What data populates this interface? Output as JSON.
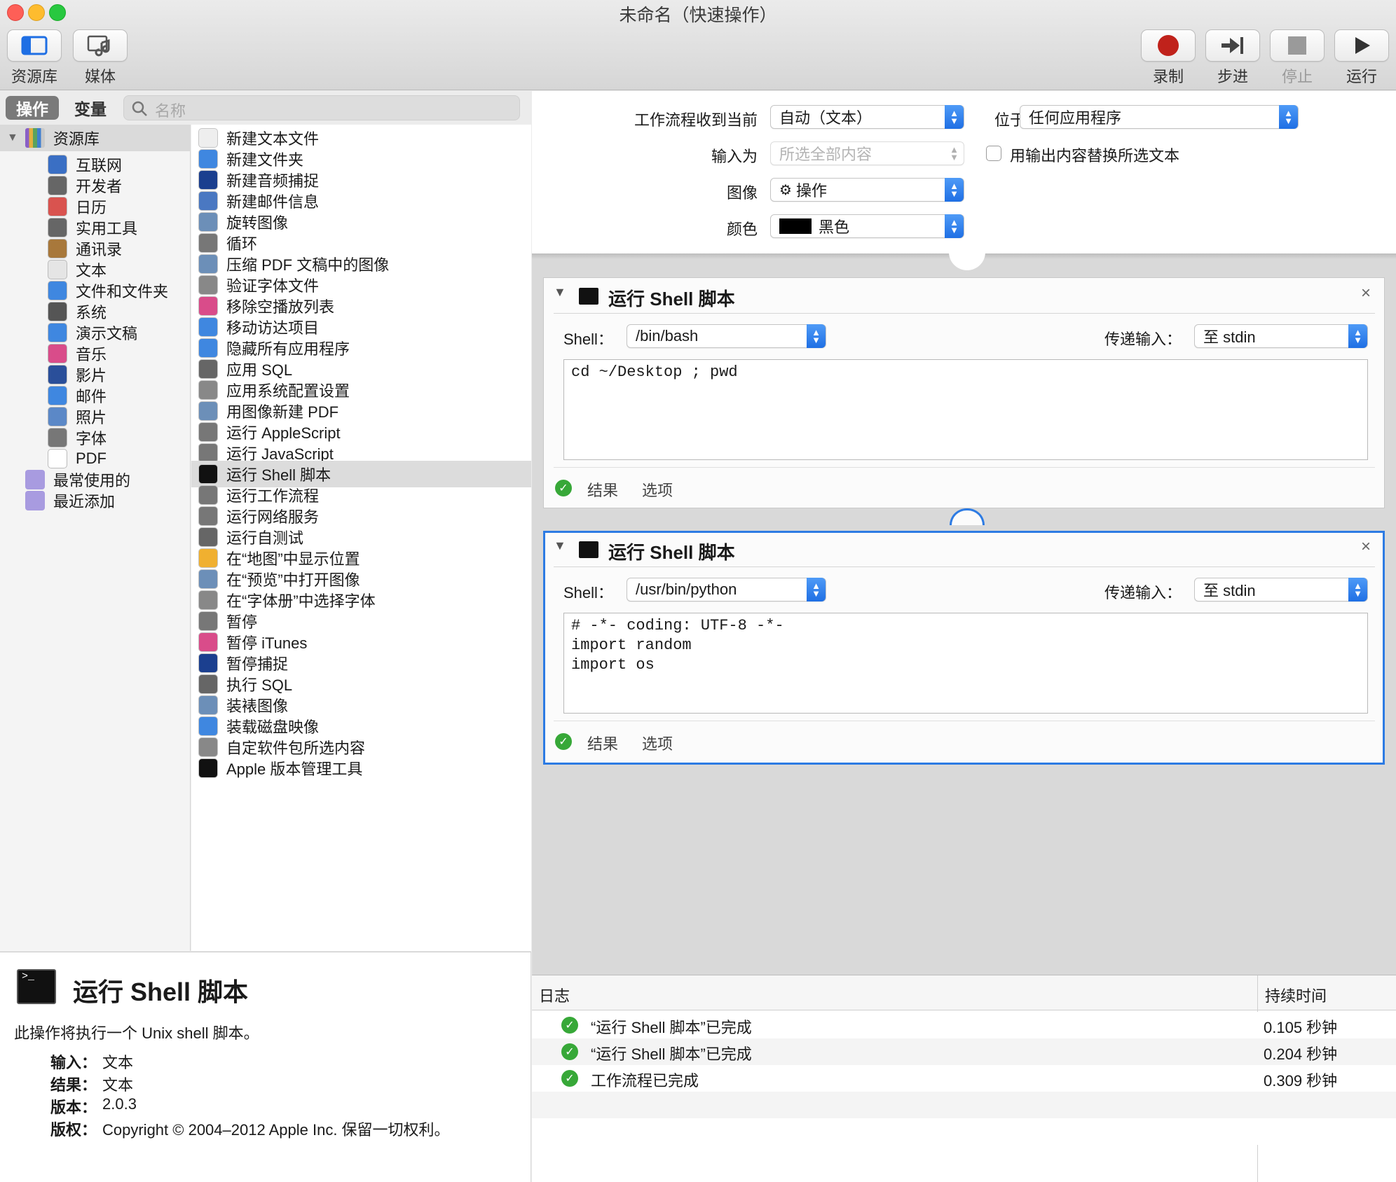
{
  "window": {
    "title": "未命名（快速操作）"
  },
  "toolbar": {
    "library_label": "资源库",
    "media_label": "媒体",
    "record_label": "录制",
    "step_label": "步进",
    "stop_label": "停止",
    "run_label": "运行"
  },
  "left": {
    "tab_actions": "操作",
    "tab_variables": "变量",
    "search_placeholder": "名称"
  },
  "library": {
    "root": "资源库",
    "items": [
      "互联网",
      "开发者",
      "日历",
      "实用工具",
      "通讯录",
      "文本",
      "文件和文件夹",
      "系统",
      "演示文稿",
      "音乐",
      "影片",
      "邮件",
      "照片",
      "字体",
      "PDF"
    ],
    "smart": [
      "最常使用的",
      "最近添加"
    ]
  },
  "actions": [
    "新建文本文件",
    "新建文件夹",
    "新建音频捕捉",
    "新建邮件信息",
    "旋转图像",
    "循环",
    "压缩 PDF 文稿中的图像",
    "验证字体文件",
    "移除空播放列表",
    "移动访达项目",
    "隐藏所有应用程序",
    "应用 SQL",
    "应用系统配置设置",
    "用图像新建 PDF",
    "运行 AppleScript",
    "运行 JavaScript",
    "运行 Shell 脚本",
    "运行工作流程",
    "运行网络服务",
    "运行自测试",
    "在“地图”中显示位置",
    "在“预览”中打开图像",
    "在“字体册”中选择字体",
    "暂停",
    "暂停 iTunes",
    "暂停捕捉",
    "执行 SQL",
    "装裱图像",
    "装载磁盘映像",
    "自定软件包所选内容",
    "Apple 版本管理工具"
  ],
  "description": {
    "title": "运行 Shell 脚本",
    "text": "此操作将执行一个 Unix shell 脚本。",
    "input_label": "输入：",
    "input_value": "文本",
    "result_label": "结果：",
    "result_value": "文本",
    "version_label": "版本：",
    "version_value": "2.0.3",
    "copyright_label": "版权：",
    "copyright_value": "Copyright © 2004–2012 Apple Inc. 保留一切权利。"
  },
  "params": {
    "receives_label": "工作流程收到当前",
    "receives_value": "自动（文本）",
    "in_label": "位于",
    "in_value": "任何应用程序",
    "input_is_label": "输入为",
    "input_is_value": "所选全部内容",
    "replace_label": "用输出内容替换所选文本",
    "image_label": "图像",
    "image_value": "操作",
    "color_label": "颜色",
    "color_value": "黑色",
    "color_swatch": "#000000"
  },
  "cards": [
    {
      "title": "运行 Shell 脚本",
      "shell_label": "Shell：",
      "shell_value": "/bin/bash",
      "pass_label": "传递输入：",
      "pass_value": "至 stdin",
      "script": "cd ~/Desktop ; pwd",
      "results_label": "结果",
      "options_label": "选项"
    },
    {
      "title": "运行 Shell 脚本",
      "shell_label": "Shell：",
      "shell_value": "/usr/bin/python",
      "pass_label": "传递输入：",
      "pass_value": "至 stdin",
      "script": "# -*- coding: UTF-8 -*-\nimport random\nimport os",
      "results_label": "结果",
      "options_label": "选项"
    }
  ],
  "log": {
    "col_log": "日志",
    "col_duration": "持续时间",
    "rows": [
      {
        "msg": "“运行 Shell 脚本”已完成",
        "dur": "0.105 秒钟"
      },
      {
        "msg": "“运行 Shell 脚本”已完成",
        "dur": "0.204 秒钟"
      },
      {
        "msg": "工作流程已完成",
        "dur": "0.309 秒钟"
      }
    ]
  },
  "colors": {
    "accent": "#2d7be3",
    "record": "#c0221b",
    "check": "#37a838"
  }
}
